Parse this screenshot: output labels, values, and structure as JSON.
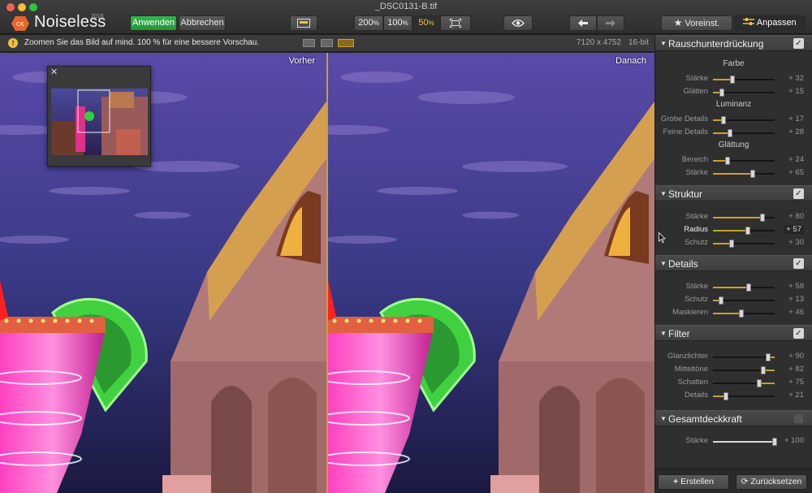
{
  "window": {
    "title": "_DSC0131-B.tif"
  },
  "app": {
    "name": "Noiseless",
    "year": "2016"
  },
  "toolbar": {
    "apply_label": "Anwenden",
    "cancel_label": "Abbrechen",
    "zoom_levels": [
      "200",
      "100",
      "50"
    ],
    "zoom_unit": "%",
    "presets_label": "Voreinst.",
    "adjust_label": "Anpassen"
  },
  "info": {
    "warning": "Zoomen Sie das Bild auf mind. 100 % für eine bessere Vorschau.",
    "image_size": "7120 x 4752",
    "bit_depth": "16-bit"
  },
  "preview": {
    "before_label": "Vorher",
    "after_label": "Danach"
  },
  "panel": {
    "sections": [
      {
        "title": "Rauschunterdrückung",
        "groups": [
          {
            "title": "Farbe",
            "sliders": [
              {
                "label": "Stärke",
                "value": "+ 32"
              },
              {
                "label": "Glätten",
                "value": "+ 15"
              }
            ]
          },
          {
            "title": "Luminanz",
            "sliders": [
              {
                "label": "Grobe Details",
                "value": "+ 17"
              },
              {
                "label": "Feine Details",
                "value": "+ 28"
              }
            ]
          },
          {
            "title": "Glättung",
            "sliders": [
              {
                "label": "Bereich",
                "value": "+ 24"
              },
              {
                "label": "Stärke",
                "value": "+ 65"
              }
            ]
          }
        ]
      },
      {
        "title": "Struktur",
        "sliders": [
          {
            "label": "Stärke",
            "value": "+ 80"
          },
          {
            "label": "Radius",
            "value": "+ 57"
          },
          {
            "label": "Schutz",
            "value": "+ 30"
          }
        ]
      },
      {
        "title": "Details",
        "sliders": [
          {
            "label": "Stärke",
            "value": "+ 58"
          },
          {
            "label": "Schutz",
            "value": "+ 13"
          },
          {
            "label": "Maskieren",
            "value": "+ 46"
          }
        ]
      },
      {
        "title": "Filter",
        "sliders": [
          {
            "label": "Glanzlichter",
            "value": "+ 90"
          },
          {
            "label": "Mitteltöne",
            "value": "+ 82"
          },
          {
            "label": "Schatten",
            "value": "+ 75"
          },
          {
            "label": "Details",
            "value": "+ 21"
          }
        ]
      },
      {
        "title": "Gesamtdeckkraft",
        "sliders": [
          {
            "label": "Stärke",
            "value": "+ 100"
          }
        ]
      }
    ],
    "create_label": "Erstellen",
    "reset_label": "Zurücksetzen"
  },
  "colors": {
    "accent": "#c8a030",
    "apply": "#28a745",
    "warning": "#f0c040"
  },
  "slider_levels": {
    "s0_0_0": 0.32,
    "s0_0_1": 0.15,
    "s0_1_0": 0.17,
    "s0_1_1": 0.28,
    "s0_2_0": 0.24,
    "s0_2_1": 0.65,
    "s1_0": 0.8,
    "s1_1": 0.57,
    "s1_2": 0.3,
    "s2_0": 0.58,
    "s2_1": 0.13,
    "s2_2": 0.46,
    "s3_0": 0.9,
    "s3_1": 0.82,
    "s3_2": 0.75,
    "s3_3": 0.21,
    "s4_0": 1.0
  }
}
